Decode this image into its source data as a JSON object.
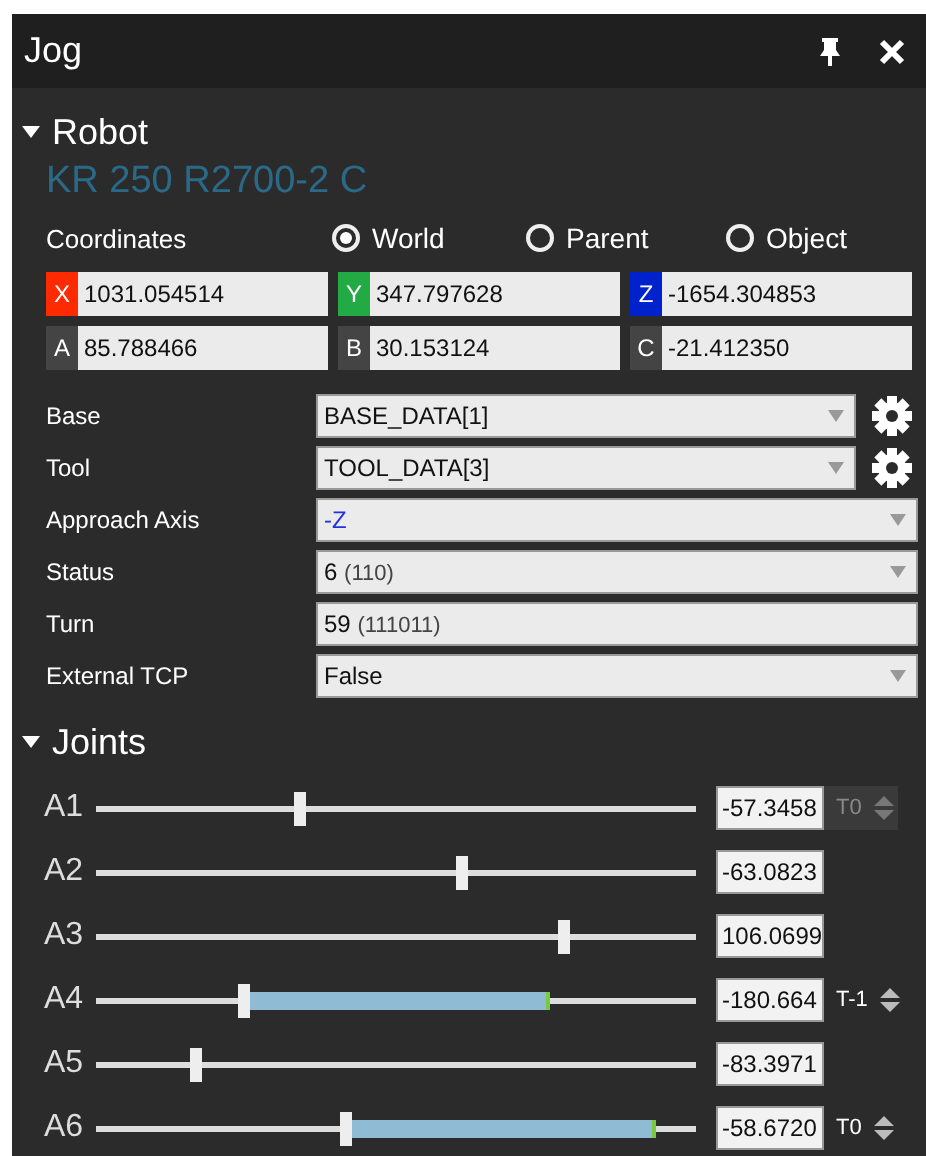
{
  "window": {
    "title": "Jog"
  },
  "robot": {
    "heading": "Robot",
    "expanded": true,
    "model": "KR 250 R2700-2 C",
    "coordinates": {
      "label": "Coordinates",
      "options": [
        {
          "label": "World",
          "selected": true
        },
        {
          "label": "Parent",
          "selected": false
        },
        {
          "label": "Object",
          "selected": false
        }
      ]
    },
    "position": [
      {
        "axis": "X",
        "value": "1031.054514",
        "color": "#ff2a00"
      },
      {
        "axis": "Y",
        "value": "347.797628",
        "color": "#22aa44"
      },
      {
        "axis": "Z",
        "value": "-1654.304853",
        "color": "#0022cc"
      },
      {
        "axis": "A",
        "value": "85.788466",
        "color": "#444444"
      },
      {
        "axis": "B",
        "value": "30.153124",
        "color": "#444444"
      },
      {
        "axis": "C",
        "value": "-21.412350",
        "color": "#444444"
      }
    ],
    "properties": [
      {
        "label": "Base",
        "value": "BASE_DATA[1]",
        "kind": "dropdown",
        "settings": true
      },
      {
        "label": "Tool",
        "value": "TOOL_DATA[3]",
        "kind": "dropdown",
        "settings": true
      },
      {
        "label": "Approach Axis",
        "value": "-Z",
        "kind": "dropdown",
        "settings": false
      },
      {
        "label": "Status",
        "value": "6",
        "detail": "(110)",
        "kind": "dropdown",
        "settings": false
      },
      {
        "label": "Turn",
        "value": "59",
        "detail": "(111011)",
        "kind": "text",
        "settings": false
      },
      {
        "label": "External TCP",
        "value": "False",
        "kind": "dropdown",
        "settings": false
      }
    ]
  },
  "joints": {
    "heading": "Joints",
    "expanded": true,
    "items": [
      {
        "name": "A1",
        "level": 0.34,
        "value": "-57.3458",
        "turn": {
          "label": "T0",
          "disabled": true
        }
      },
      {
        "name": "A2",
        "level": 0.61,
        "value": "-63.0823"
      },
      {
        "name": "A3",
        "level": 0.78,
        "value": "106.0699"
      },
      {
        "name": "A4",
        "level": 0.247,
        "band": {
          "level": 0.753
        },
        "value": "-180.664",
        "turn": {
          "label": "T-1",
          "disabled": false
        }
      },
      {
        "name": "A5",
        "level": 0.167,
        "value": "-83.3971"
      },
      {
        "name": "A6",
        "level": 0.417,
        "band": {
          "level": 0.93
        },
        "value": "-58.6720",
        "turn": {
          "label": "T0",
          "disabled": false
        }
      }
    ]
  }
}
